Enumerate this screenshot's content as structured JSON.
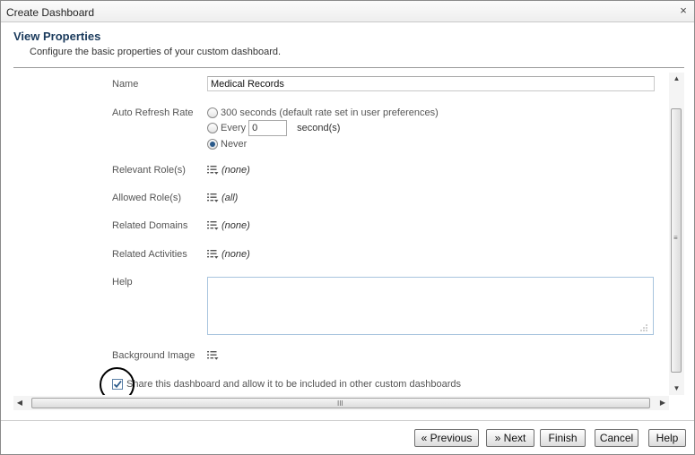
{
  "window": {
    "title": "Create Dashboard",
    "close_glyph": "×"
  },
  "header": {
    "title": "View Properties",
    "subtitle": "Configure the basic properties of your custom dashboard."
  },
  "form": {
    "name": {
      "label": "Name",
      "value": "Medical Records"
    },
    "auto_refresh": {
      "label": "Auto Refresh Rate",
      "options": [
        {
          "label": "300 seconds (default rate set in user preferences)",
          "selected": false
        },
        {
          "label": "Every",
          "selected": false
        },
        {
          "label": "Never",
          "selected": true
        }
      ],
      "every_value": "0",
      "every_unit": "second(s)"
    },
    "relevant_roles": {
      "label": "Relevant Role(s)",
      "value": "(none)"
    },
    "allowed_roles": {
      "label": "Allowed Role(s)",
      "value": "(all)"
    },
    "related_domains": {
      "label": "Related Domains",
      "value": "(none)"
    },
    "related_activities": {
      "label": "Related Activities",
      "value": "(none)"
    },
    "help": {
      "label": "Help",
      "value": ""
    },
    "background_image": {
      "label": "Background Image"
    },
    "share": {
      "label": "Share this dashboard and allow it to be included in other custom dashboards",
      "checked": true
    }
  },
  "icons": {
    "picker": "list-picker-icon",
    "check": "check-icon",
    "scroll_up": "▲",
    "scroll_down": "▼",
    "scroll_left": "◀",
    "scroll_right": "▶",
    "grip_v": "≡",
    "grip_h": "III"
  },
  "buttons": {
    "previous": "« Previous",
    "next": "» Next",
    "finish": "Finish",
    "cancel": "Cancel",
    "help": "Help"
  },
  "colors": {
    "title_text": "#1a3a5c",
    "radio_selected": "#2b5a8a",
    "help_border": "#a8c4de",
    "check": "#2b5a8a"
  }
}
